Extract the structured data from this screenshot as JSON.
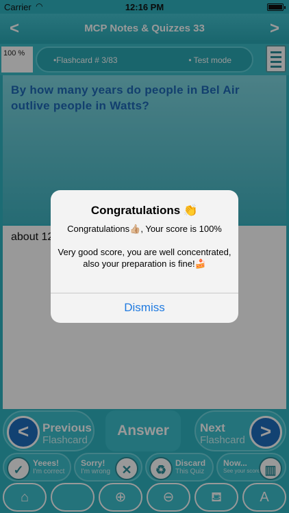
{
  "status": {
    "carrier": "Carrier",
    "wifi": "wifi-icon",
    "time": "12:16 PM",
    "battery": "battery-icon"
  },
  "nav": {
    "back": "<",
    "title": "MCP Notes & Quizzes 33",
    "forward": ">"
  },
  "info": {
    "score_pct": "100 %",
    "flashcard": "•Flashcard # 3/83",
    "mode": "• Test mode"
  },
  "question": {
    "text": "By how many years do people in Bel Air outlive people in Watts?"
  },
  "answer": {
    "text": "about 12"
  },
  "controls": {
    "previous": {
      "label": "Previous",
      "sub": "Flashcard",
      "icon": "<"
    },
    "answer": "Answer",
    "next": {
      "label": "Next",
      "sub": "Flashcard",
      "icon": ">"
    },
    "yes": {
      "label": "Yeees!",
      "sub": "I'm correct",
      "icon": "✓"
    },
    "sorry": {
      "label": "Sorry!",
      "sub": "I'm wrong",
      "icon": "✕"
    },
    "discard": {
      "label": "Discard",
      "sub": "This Quiz",
      "icon": "♻"
    },
    "now": {
      "label": "Now...",
      "sub": "See your score",
      "icon": "▥"
    }
  },
  "tools": [
    "⌂",
    "",
    "⊕",
    "⊖",
    "⛾",
    "A"
  ],
  "dialog": {
    "title": "Congratulations 👏",
    "line1": "Congratulations👍🏼, Your score is 100%",
    "line2": "Very good score, you are well concentrated, also your preparation is fine!🍰",
    "dismiss": "Dismiss"
  }
}
